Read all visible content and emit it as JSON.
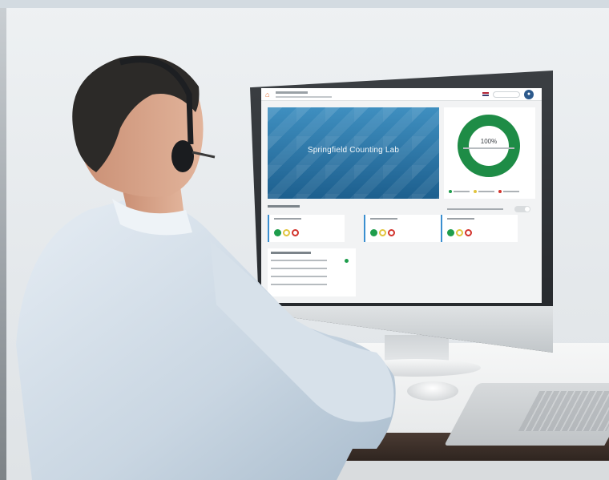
{
  "monitor_app": {
    "banner_title": "Springfield Counting Lab",
    "donut_percent": "100%",
    "colors": {
      "banner": "#2a76a8",
      "donut_green": "#1e8c46",
      "status_green": "#1e9d4c",
      "status_yellow": "#e1c43d",
      "status_red": "#d2332c",
      "accent_blue": "#3a8fd0"
    },
    "metrics": [
      {
        "lights": [
          "green",
          "yellow",
          "red"
        ]
      },
      {
        "lights": [
          "green",
          "yellow",
          "red"
        ]
      },
      {
        "lights": [
          "green",
          "yellow",
          "red"
        ]
      }
    ],
    "donut_value": 1.0
  },
  "scene_objects": [
    "person-with-headset",
    "monitor",
    "desk",
    "mouse",
    "laptop"
  ]
}
